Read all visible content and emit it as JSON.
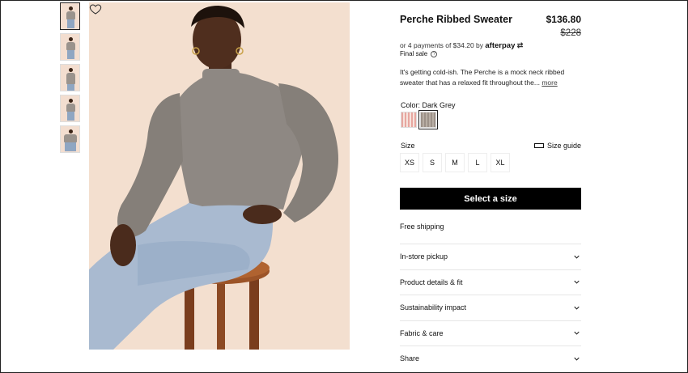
{
  "product": {
    "name": "Perche Ribbed Sweater",
    "price": "$136.80",
    "original_price": "$228",
    "afterpay_text": "or 4 payments of $34.20 by",
    "afterpay_brand": "afterpay",
    "final_sale": "Final sale",
    "description": "It's getting cold-ish. The Perche is a mock neck ribbed sweater that has a relaxed fit throughout the...",
    "more_link": "more"
  },
  "color": {
    "label": "Color: Dark Grey",
    "swatches": [
      "pink-stripe",
      "dark-grey"
    ],
    "selected": "dark-grey"
  },
  "size": {
    "label": "Size",
    "guide_label": "Size guide",
    "options": [
      "XS",
      "S",
      "M",
      "L",
      "XL"
    ]
  },
  "cta": {
    "label": "Select a size"
  },
  "shipping": "Free shipping",
  "accordion": [
    "In-store pickup",
    "Product details & fit",
    "Sustainability impact",
    "Fabric & care",
    "Share"
  ],
  "icons": {
    "wishlist": "heart-icon",
    "info": "info-icon",
    "ruler": "ruler-icon",
    "chevron": "chevron-down-icon"
  },
  "colors": {
    "background": "#ffffff",
    "cta": "#000000",
    "image_bg": "#f3dfcf"
  }
}
